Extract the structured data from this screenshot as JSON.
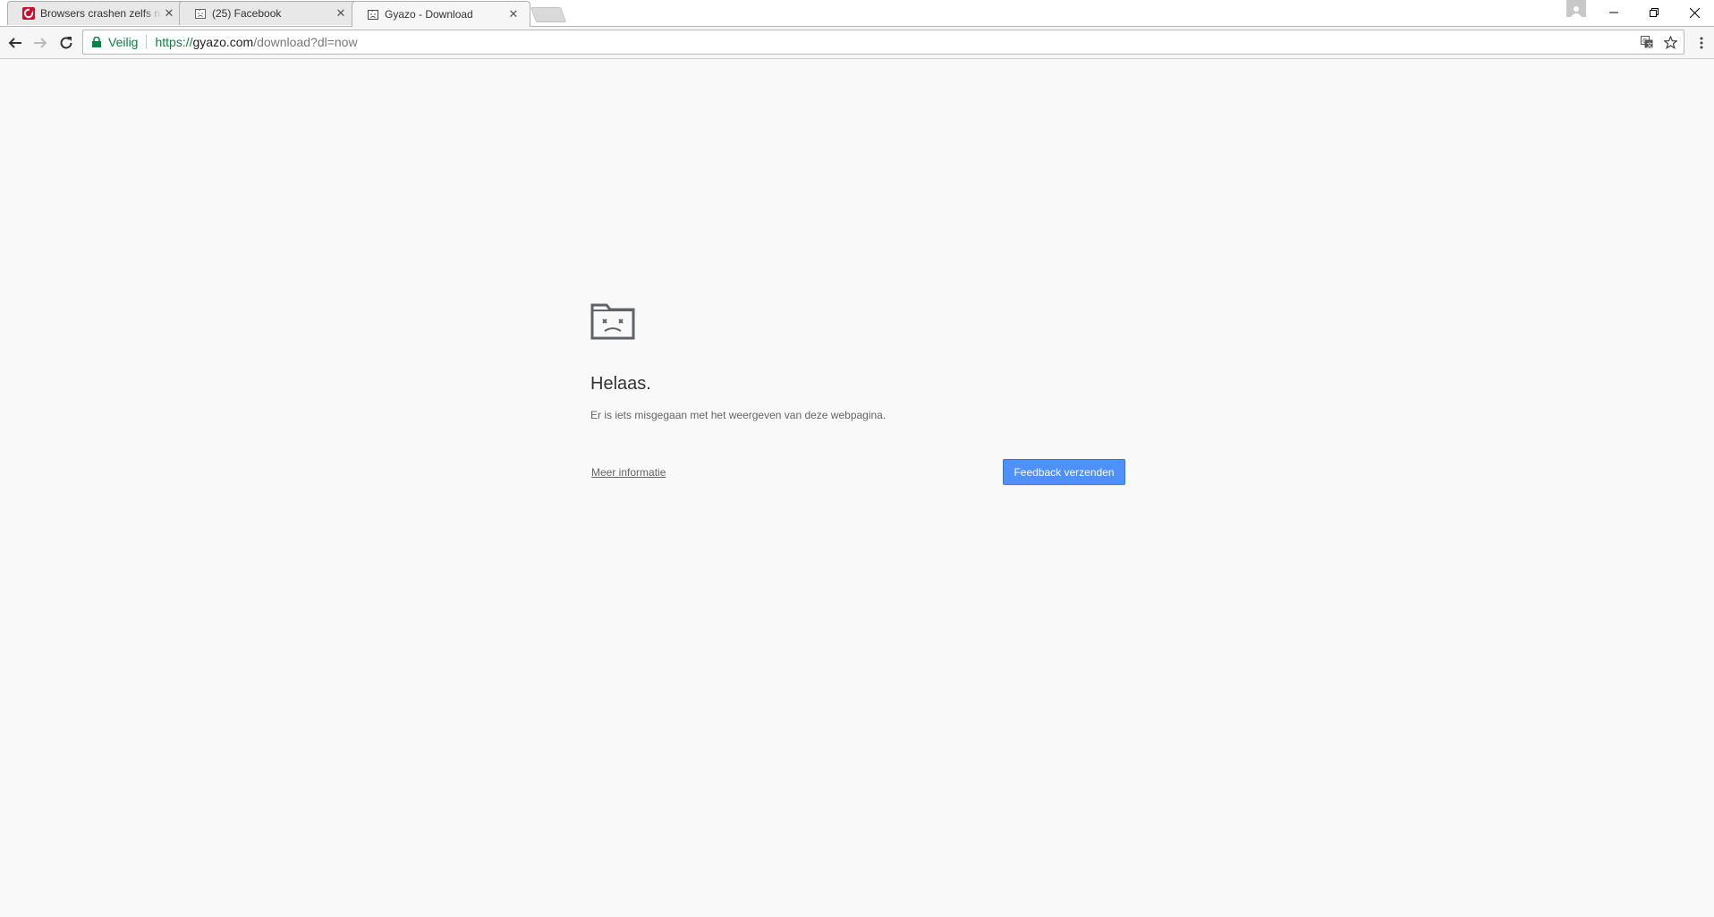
{
  "tabs": [
    {
      "title": "Browsers crashen zelfs na",
      "favicon": "tweakers-icon"
    },
    {
      "title": "(25) Facebook",
      "favicon": "sad-page-icon"
    },
    {
      "title": "Gyazo - Download",
      "favicon": "sad-page-icon",
      "active": true
    }
  ],
  "omnibox": {
    "secure_label": "Veilig",
    "url_scheme": "https://",
    "url_host": "gyazo.com",
    "url_path": "/download?dl=now"
  },
  "error_page": {
    "title": "Helaas.",
    "message": "Er is iets misgegaan met het weergeven van deze webpagina.",
    "more_info_link": "Meer informatie",
    "feedback_button": "Feedback verzenden"
  },
  "colors": {
    "accent": "#4d90fe",
    "secure_green": "#0b8043",
    "page_bg": "#f9f9f9"
  }
}
